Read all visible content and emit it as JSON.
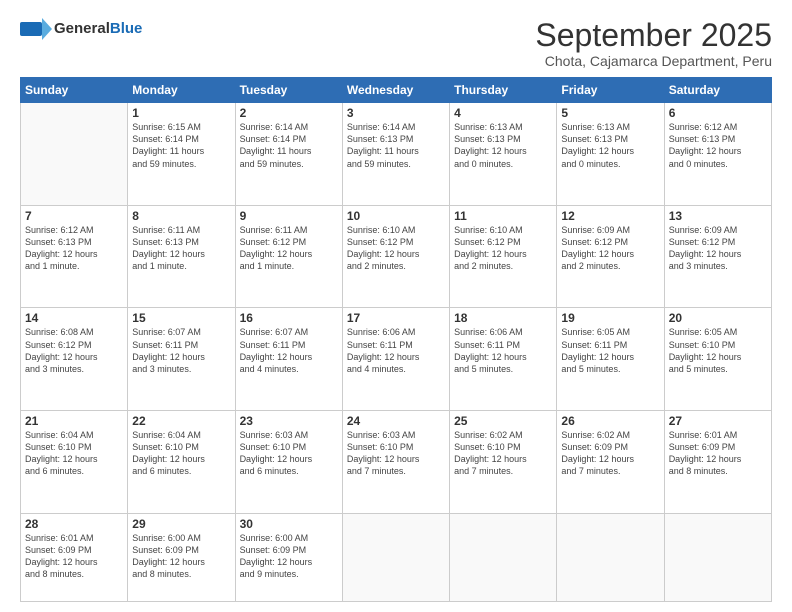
{
  "header": {
    "logo_general": "General",
    "logo_blue": "Blue",
    "month_title": "September 2025",
    "subtitle": "Chota, Cajamarca Department, Peru"
  },
  "days_of_week": [
    "Sunday",
    "Monday",
    "Tuesday",
    "Wednesday",
    "Thursday",
    "Friday",
    "Saturday"
  ],
  "weeks": [
    [
      {
        "day": "",
        "content": ""
      },
      {
        "day": "1",
        "content": "Sunrise: 6:15 AM\nSunset: 6:14 PM\nDaylight: 11 hours\nand 59 minutes."
      },
      {
        "day": "2",
        "content": "Sunrise: 6:14 AM\nSunset: 6:14 PM\nDaylight: 11 hours\nand 59 minutes."
      },
      {
        "day": "3",
        "content": "Sunrise: 6:14 AM\nSunset: 6:13 PM\nDaylight: 11 hours\nand 59 minutes."
      },
      {
        "day": "4",
        "content": "Sunrise: 6:13 AM\nSunset: 6:13 PM\nDaylight: 12 hours\nand 0 minutes."
      },
      {
        "day": "5",
        "content": "Sunrise: 6:13 AM\nSunset: 6:13 PM\nDaylight: 12 hours\nand 0 minutes."
      },
      {
        "day": "6",
        "content": "Sunrise: 6:12 AM\nSunset: 6:13 PM\nDaylight: 12 hours\nand 0 minutes."
      }
    ],
    [
      {
        "day": "7",
        "content": "Sunrise: 6:12 AM\nSunset: 6:13 PM\nDaylight: 12 hours\nand 1 minute."
      },
      {
        "day": "8",
        "content": "Sunrise: 6:11 AM\nSunset: 6:13 PM\nDaylight: 12 hours\nand 1 minute."
      },
      {
        "day": "9",
        "content": "Sunrise: 6:11 AM\nSunset: 6:12 PM\nDaylight: 12 hours\nand 1 minute."
      },
      {
        "day": "10",
        "content": "Sunrise: 6:10 AM\nSunset: 6:12 PM\nDaylight: 12 hours\nand 2 minutes."
      },
      {
        "day": "11",
        "content": "Sunrise: 6:10 AM\nSunset: 6:12 PM\nDaylight: 12 hours\nand 2 minutes."
      },
      {
        "day": "12",
        "content": "Sunrise: 6:09 AM\nSunset: 6:12 PM\nDaylight: 12 hours\nand 2 minutes."
      },
      {
        "day": "13",
        "content": "Sunrise: 6:09 AM\nSunset: 6:12 PM\nDaylight: 12 hours\nand 3 minutes."
      }
    ],
    [
      {
        "day": "14",
        "content": "Sunrise: 6:08 AM\nSunset: 6:12 PM\nDaylight: 12 hours\nand 3 minutes."
      },
      {
        "day": "15",
        "content": "Sunrise: 6:07 AM\nSunset: 6:11 PM\nDaylight: 12 hours\nand 3 minutes."
      },
      {
        "day": "16",
        "content": "Sunrise: 6:07 AM\nSunset: 6:11 PM\nDaylight: 12 hours\nand 4 minutes."
      },
      {
        "day": "17",
        "content": "Sunrise: 6:06 AM\nSunset: 6:11 PM\nDaylight: 12 hours\nand 4 minutes."
      },
      {
        "day": "18",
        "content": "Sunrise: 6:06 AM\nSunset: 6:11 PM\nDaylight: 12 hours\nand 5 minutes."
      },
      {
        "day": "19",
        "content": "Sunrise: 6:05 AM\nSunset: 6:11 PM\nDaylight: 12 hours\nand 5 minutes."
      },
      {
        "day": "20",
        "content": "Sunrise: 6:05 AM\nSunset: 6:10 PM\nDaylight: 12 hours\nand 5 minutes."
      }
    ],
    [
      {
        "day": "21",
        "content": "Sunrise: 6:04 AM\nSunset: 6:10 PM\nDaylight: 12 hours\nand 6 minutes."
      },
      {
        "day": "22",
        "content": "Sunrise: 6:04 AM\nSunset: 6:10 PM\nDaylight: 12 hours\nand 6 minutes."
      },
      {
        "day": "23",
        "content": "Sunrise: 6:03 AM\nSunset: 6:10 PM\nDaylight: 12 hours\nand 6 minutes."
      },
      {
        "day": "24",
        "content": "Sunrise: 6:03 AM\nSunset: 6:10 PM\nDaylight: 12 hours\nand 7 minutes."
      },
      {
        "day": "25",
        "content": "Sunrise: 6:02 AM\nSunset: 6:10 PM\nDaylight: 12 hours\nand 7 minutes."
      },
      {
        "day": "26",
        "content": "Sunrise: 6:02 AM\nSunset: 6:09 PM\nDaylight: 12 hours\nand 7 minutes."
      },
      {
        "day": "27",
        "content": "Sunrise: 6:01 AM\nSunset: 6:09 PM\nDaylight: 12 hours\nand 8 minutes."
      }
    ],
    [
      {
        "day": "28",
        "content": "Sunrise: 6:01 AM\nSunset: 6:09 PM\nDaylight: 12 hours\nand 8 minutes."
      },
      {
        "day": "29",
        "content": "Sunrise: 6:00 AM\nSunset: 6:09 PM\nDaylight: 12 hours\nand 8 minutes."
      },
      {
        "day": "30",
        "content": "Sunrise: 6:00 AM\nSunset: 6:09 PM\nDaylight: 12 hours\nand 9 minutes."
      },
      {
        "day": "",
        "content": ""
      },
      {
        "day": "",
        "content": ""
      },
      {
        "day": "",
        "content": ""
      },
      {
        "day": "",
        "content": ""
      }
    ]
  ]
}
